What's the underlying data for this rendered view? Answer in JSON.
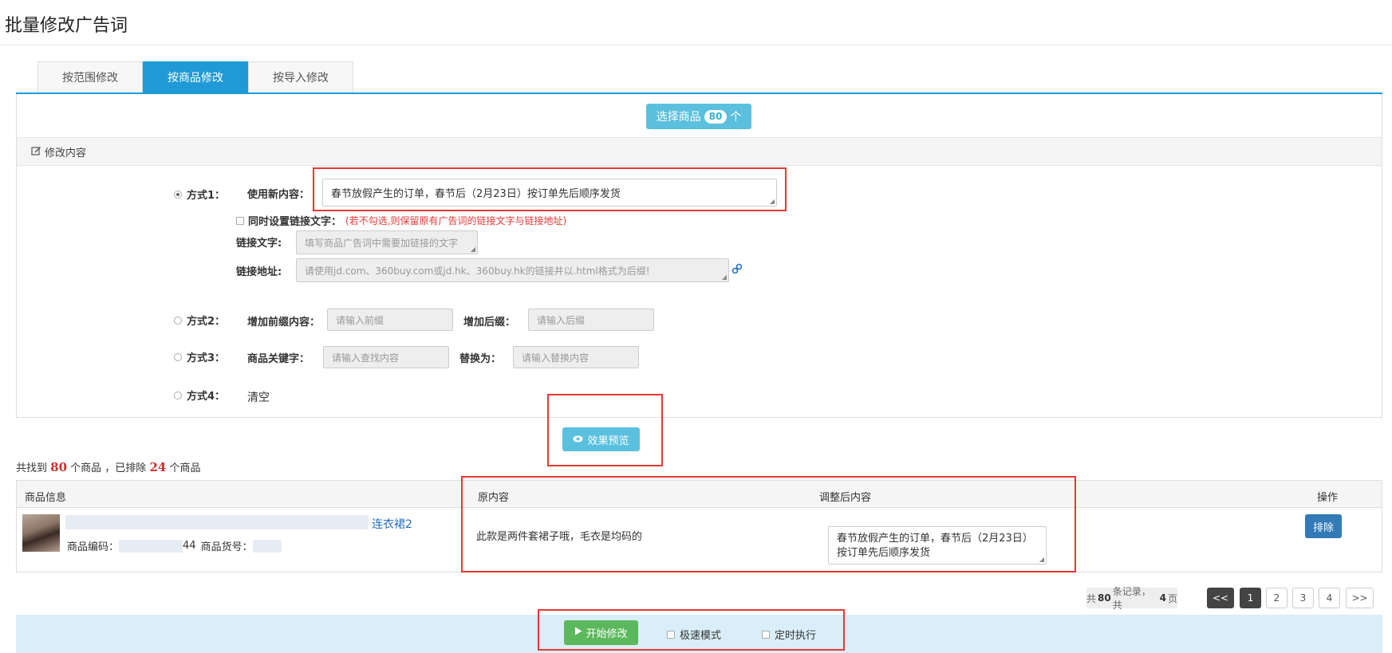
{
  "page": {
    "title": "批量修改广告词"
  },
  "tabs": [
    {
      "label": "按范围修改",
      "active": false
    },
    {
      "label": "按商品修改",
      "active": true
    },
    {
      "label": "按导入修改",
      "active": false
    }
  ],
  "select_goods": {
    "label": "选择商品",
    "count": "80",
    "unit": "个"
  },
  "section": {
    "title": "修改内容",
    "icon": "edit-icon"
  },
  "method1": {
    "label": "方式1：",
    "content_label": "使用新内容：",
    "content_value": "春节放假产生的订单，春节后（2月23日）按订单先后顺序发货",
    "link_checkbox_label": "同时设置链接文字：",
    "link_hint": "(若不勾选,则保留原有广告词的链接文字与链接地址)",
    "link_text_label": "链接文字:",
    "link_text_placeholder": "填写商品广告词中需要加链接的文字",
    "link_url_label": "链接地址:",
    "link_url_placeholder": "请使用jd.com、360buy.com或jd.hk、360buy.hk的链接并以.html格式为后缀!",
    "link_icon": "link-icon"
  },
  "method2": {
    "label": "方式2：",
    "prefix_label": "增加前缀内容：",
    "prefix_placeholder": "请输入前缀",
    "suffix_label": "增加后缀：",
    "suffix_placeholder": "请输入后缀"
  },
  "method3": {
    "label": "方式3：",
    "keyword_label": "商品关键字：",
    "keyword_placeholder": "请输入查找内容",
    "replace_label": "替换为：",
    "replace_placeholder": "请输入替换内容"
  },
  "method4": {
    "label": "方式4：",
    "value": "清空"
  },
  "preview_button": {
    "label": "效果预览",
    "icon": "eye-icon"
  },
  "summary": {
    "prefix": "共找到",
    "found": "80",
    "mid": "个商品 ，已排除",
    "excluded": "24",
    "suffix": "个商品"
  },
  "table": {
    "headers": {
      "info": "商品信息",
      "original": "原内容",
      "adjusted": "调整后内容",
      "action": "操作"
    },
    "rows": [
      {
        "title_tail": "连衣裙2",
        "code_label": "商品编码：",
        "code_tail": "44",
        "sku_label": "商品货号：",
        "original": "此款是两件套裙子哦，毛衣是均码的",
        "adjusted": "春节放假产生的订单，春节后（2月23日）按订单先后顺序发货",
        "action": "排除"
      }
    ]
  },
  "pagination": {
    "total_prefix": "共",
    "total_records": "80",
    "records_unit": "条记录，共",
    "total_pages": "4",
    "pages_unit": "页",
    "first": "<<",
    "pages": [
      "1",
      "2",
      "3",
      "4"
    ],
    "current": "1",
    "last": ">>"
  },
  "bottom": {
    "start_label": "开始修改",
    "start_icon": "play-icon",
    "fast_mode": "极速模式",
    "scheduled": "定时执行"
  }
}
